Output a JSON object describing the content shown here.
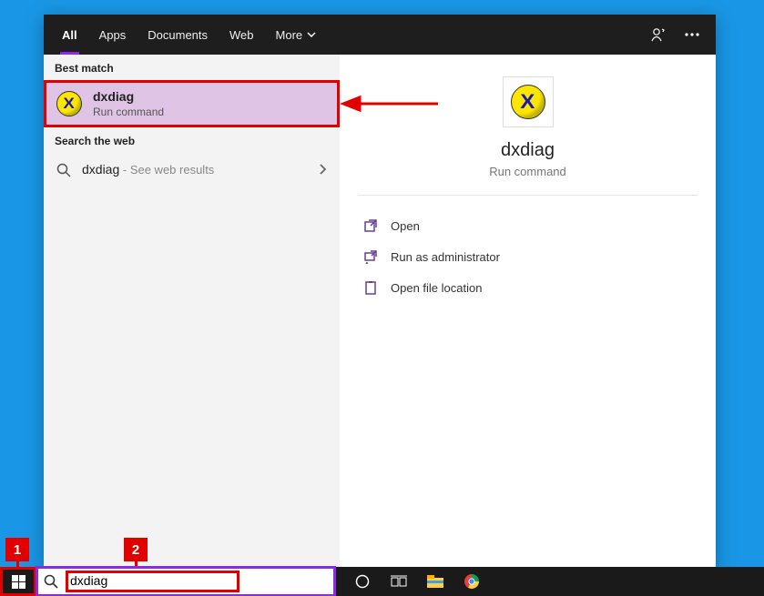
{
  "tabs": {
    "all": "All",
    "apps": "Apps",
    "documents": "Documents",
    "web": "Web",
    "more": "More"
  },
  "sections": {
    "best_match": "Best match",
    "search_web": "Search the web"
  },
  "best_match": {
    "title": "dxdiag",
    "subtitle": "Run command"
  },
  "web_result": {
    "query": "dxdiag",
    "suffix": " - See web results"
  },
  "detail": {
    "title": "dxdiag",
    "subtitle": "Run command"
  },
  "actions": {
    "open": "Open",
    "run_admin": "Run as administrator",
    "open_loc": "Open file location"
  },
  "search_box": {
    "value": "dxdiag"
  },
  "annotations": {
    "badge1": "1",
    "badge2": "2"
  }
}
